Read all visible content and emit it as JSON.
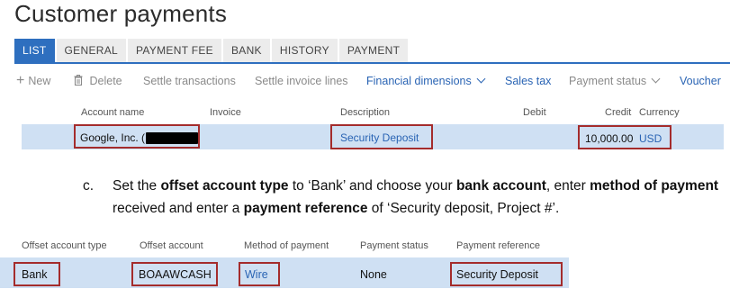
{
  "page": {
    "title": "Customer payments"
  },
  "tabs": [
    "LIST",
    "GENERAL",
    "PAYMENT FEE",
    "BANK",
    "HISTORY",
    "PAYMENT"
  ],
  "toolbar": {
    "new_label": "New",
    "delete_label": "Delete",
    "settle_transactions_label": "Settle transactions",
    "settle_invoice_lines_label": "Settle invoice lines",
    "financial_dimensions_label": "Financial dimensions",
    "sales_tax_label": "Sales tax",
    "payment_status_label": "Payment status",
    "voucher_label": "Voucher"
  },
  "grid": {
    "headers": {
      "account_name": "Account name",
      "invoice": "Invoice",
      "description": "Description",
      "debit": "Debit",
      "credit": "Credit",
      "currency": "Currency"
    },
    "row": {
      "account_name": "Google, Inc. (",
      "description": "Security Deposit",
      "credit": "10,000.00",
      "currency": "USD"
    }
  },
  "instruction": {
    "letter": "c.",
    "parts": [
      "Set the ",
      "offset account type",
      " to ‘Bank’ and choose your ",
      "bank account",
      ", enter ",
      "method of payment",
      " received and enter a ",
      "payment reference",
      " of ‘Security deposit, Project #’."
    ]
  },
  "grid2": {
    "headers": {
      "offset_account_type": "Offset account type",
      "offset_account": "Offset account",
      "method_of_payment": "Method of payment",
      "payment_status": "Payment status",
      "payment_reference": "Payment reference"
    },
    "row": {
      "offset_account_type": "Bank",
      "offset_account": "BOAAWCASH",
      "method_of_payment": "Wire",
      "payment_status": "None",
      "payment_reference": "Security Deposit"
    }
  },
  "colors": {
    "accent": "#2e6fbf",
    "link": "#2a64b4",
    "row_highlight": "#cfe0f3",
    "callout_border": "#a42c2c"
  }
}
